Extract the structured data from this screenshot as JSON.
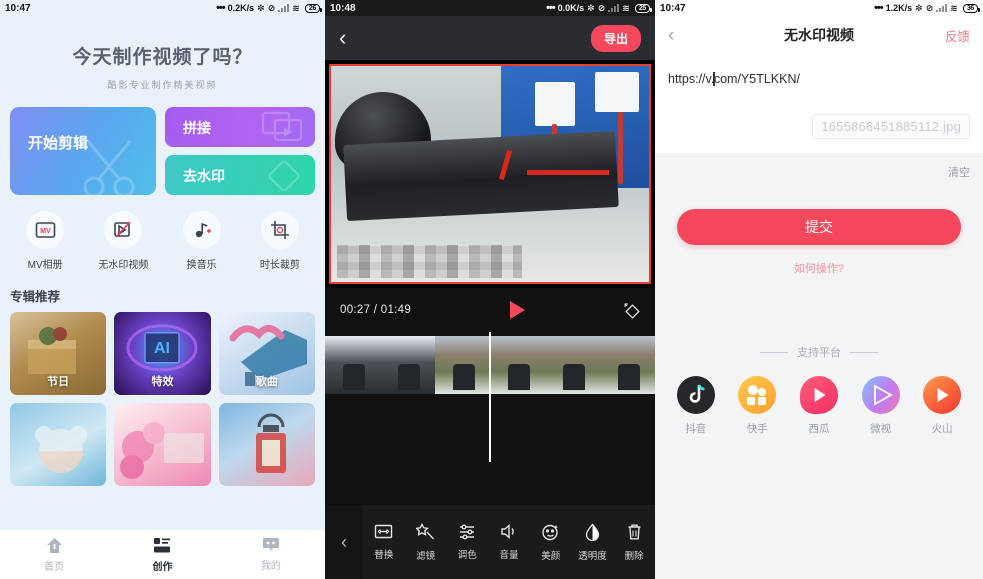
{
  "panels": {
    "home": {
      "status": {
        "time": "10:47",
        "net": "0.2K/s",
        "battery": "26"
      },
      "hero": {
        "title": "今天制作视频了吗？",
        "subtitle": "酷影专业制作精美视频"
      },
      "cards": {
        "primary": {
          "label": "开始剪辑",
          "icon": "scissors-icon"
        },
        "secondary": [
          {
            "label": "拼接",
            "icon": "video-frames-icon"
          },
          {
            "label": "去水印",
            "icon": "eraser-icon"
          }
        ]
      },
      "quick_actions": [
        {
          "label": "MV相册",
          "icon": "mv-album-icon"
        },
        {
          "label": "无水印视频",
          "icon": "no-watermark-icon"
        },
        {
          "label": "换音乐",
          "icon": "music-note-icon"
        },
        {
          "label": "时长裁剪",
          "icon": "crop-duration-icon"
        }
      ],
      "section_title": "专辑推荐",
      "albums": [
        {
          "caption": "节日"
        },
        {
          "caption": "特效"
        },
        {
          "caption": "歌曲"
        },
        {
          "caption": ""
        },
        {
          "caption": ""
        },
        {
          "caption": ""
        }
      ],
      "tabs": [
        {
          "label": "首页",
          "icon": "home-icon",
          "active": false
        },
        {
          "label": "创作",
          "icon": "create-icon",
          "active": true
        },
        {
          "label": "我的",
          "icon": "profile-icon",
          "active": false
        }
      ]
    },
    "editor": {
      "status": {
        "time": "10:48",
        "net": "0.0K/s",
        "battery": "25"
      },
      "back_icon": "chevron-left-icon",
      "export_label": "导出",
      "time_display": "00:27 / 01:49",
      "play_icon": "play-icon",
      "keyframe_icon": "keyframe-diamond-icon",
      "tools_back_icon": "chevron-left-icon",
      "tools": [
        {
          "label": "替换",
          "icon": "replace-icon"
        },
        {
          "label": "滤镜",
          "icon": "filter-wand-icon"
        },
        {
          "label": "调色",
          "icon": "color-adjust-icon"
        },
        {
          "label": "音量",
          "icon": "volume-icon"
        },
        {
          "label": "美颜",
          "icon": "beauty-face-icon"
        },
        {
          "label": "透明度",
          "icon": "opacity-drop-icon"
        },
        {
          "label": "删除",
          "icon": "trash-icon"
        }
      ]
    },
    "watermark": {
      "status": {
        "time": "10:47",
        "net": "1.2K/s",
        "battery": "36"
      },
      "back_icon": "chevron-left-icon",
      "title": "无水印视频",
      "feedback_label": "反馈",
      "url_before_caret": "https://v.",
      "url_after_caret": "com/Y5TLKKN/",
      "filename": "1655866451885112.jpg",
      "clear_label": "清空",
      "submit_label": "提交",
      "howto_label": "如何操作?",
      "platforms_heading": "支持平台",
      "platforms": [
        {
          "label": "抖音",
          "icon": "douyin-icon"
        },
        {
          "label": "快手",
          "icon": "kuaishou-icon"
        },
        {
          "label": "西瓜",
          "icon": "xigua-icon"
        },
        {
          "label": "微视",
          "icon": "weishi-icon"
        },
        {
          "label": "火山",
          "icon": "huoshan-icon"
        }
      ]
    }
  },
  "colors": {
    "accent_red": "#f6485d",
    "home_bg": "#e9f1fb",
    "editor_bg": "#111111"
  }
}
